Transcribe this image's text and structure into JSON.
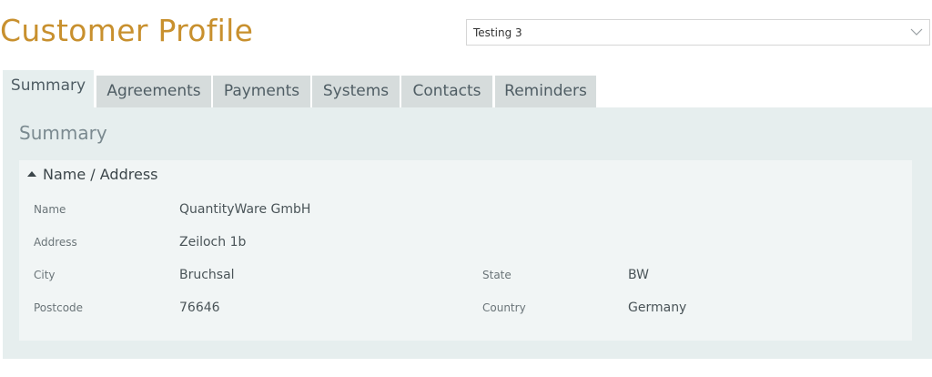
{
  "page_title": "Customer Profile",
  "selector": {
    "selected_value": "Testing 3",
    "icon": "chevron-down-icon"
  },
  "tabs": [
    {
      "label": "Summary",
      "active": true
    },
    {
      "label": "Agreements",
      "active": false
    },
    {
      "label": "Payments",
      "active": false
    },
    {
      "label": "Systems",
      "active": false
    },
    {
      "label": "Contacts",
      "active": false
    },
    {
      "label": "Reminders",
      "active": false
    }
  ],
  "summary": {
    "heading": "Summary",
    "section": {
      "title": "Name / Address",
      "icon": "collapse-triangle-icon",
      "fields": {
        "name": {
          "label": "Name",
          "value": "QuantityWare GmbH"
        },
        "address": {
          "label": "Address",
          "value": "Zeiloch 1b"
        },
        "city": {
          "label": "City",
          "value": "Bruchsal"
        },
        "state": {
          "label": "State",
          "value": "BW"
        },
        "postcode": {
          "label": "Postcode",
          "value": "76646"
        },
        "country": {
          "label": "Country",
          "value": "Germany"
        }
      }
    }
  },
  "colors": {
    "title": "#c8902e",
    "panel_bg": "#e6eeee",
    "tab_bg": "#d6dcdc",
    "card_bg": "#f1f5f5"
  }
}
